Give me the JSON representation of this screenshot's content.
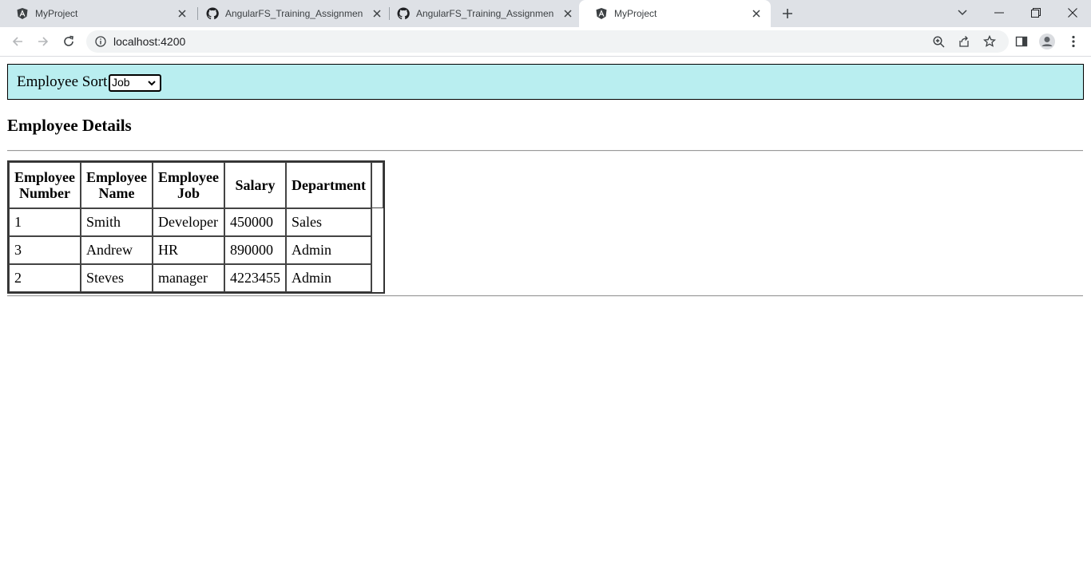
{
  "browser": {
    "tabs": [
      {
        "title": "MyProject",
        "icon": "angular-icon",
        "active": false
      },
      {
        "title": "AngularFS_Training_Assignments",
        "icon": "github-icon",
        "active": false
      },
      {
        "title": "AngularFS_Training_Assignments",
        "icon": "github-icon",
        "active": false
      },
      {
        "title": "MyProject",
        "icon": "angular-icon",
        "active": true
      }
    ],
    "url": "localhost:4200"
  },
  "sort": {
    "label": "Employee Sort:",
    "selected": "Job"
  },
  "heading": "Employee Details",
  "table": {
    "headers": [
      [
        "Employee",
        "Number"
      ],
      [
        "Employee",
        "Name"
      ],
      [
        "Employee",
        "Job"
      ],
      [
        "Salary"
      ],
      [
        "Department"
      ]
    ],
    "rows": [
      [
        "1",
        "Smith",
        "Developer",
        "450000",
        "Sales"
      ],
      [
        "3",
        "Andrew",
        "HR",
        "890000",
        "Admin"
      ],
      [
        "2",
        "Steves",
        "manager",
        "4223455",
        "Admin"
      ]
    ]
  },
  "colors": {
    "sort_bar_bg": "#b9eef0",
    "tabstrip_bg": "#dee1e6"
  }
}
